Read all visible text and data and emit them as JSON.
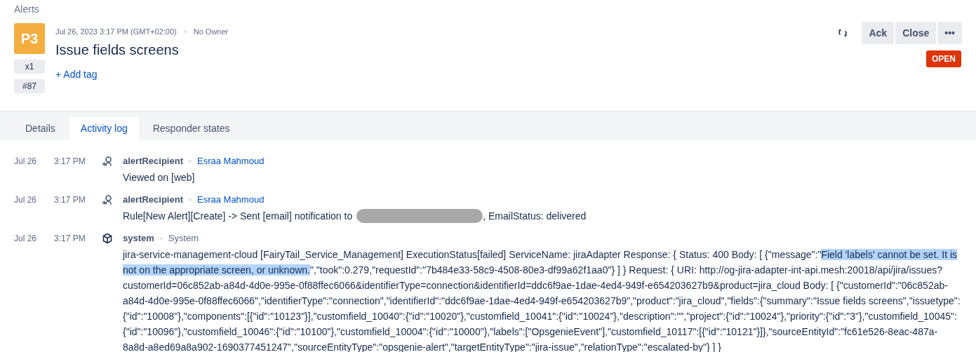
{
  "breadcrumb": "Alerts",
  "alert": {
    "priority": "P3",
    "count": "x1",
    "number": "#87",
    "datetime": "Jul 26, 2023 3:17 PM (GMT+02:00)",
    "owner": "No Owner",
    "title": "Issue fields screens",
    "add_tag": "+ Add tag",
    "status": "OPEN"
  },
  "actions": [
    "Ack",
    "Close",
    "•••"
  ],
  "tabs": [
    {
      "label": "Details",
      "selected": false
    },
    {
      "label": "Activity log",
      "selected": true
    },
    {
      "label": "Responder states",
      "selected": false
    }
  ],
  "log": [
    {
      "date": "Jul 26",
      "time": "3:17 PM",
      "kind": "user",
      "actor": "alertRecipient",
      "source": "Esraa Mahmoud",
      "source_link": true,
      "message": [
        {
          "text": "Viewed on [web]",
          "highlighted": false
        }
      ]
    },
    {
      "date": "Jul 26",
      "time": "3:17 PM",
      "kind": "user",
      "actor": "alertRecipient",
      "source": "Esraa Mahmoud",
      "source_link": true,
      "message": [
        {
          "text": "Rule[New Alert][Create] -> Sent [email] notification to",
          "highlighted": false
        }
      ],
      "redacted": true,
      "message_after": ", EmailStatus: delivered"
    },
    {
      "date": "Jul 26",
      "time": "3:17 PM",
      "kind": "system",
      "actor": "system",
      "source": "System",
      "source_link": false,
      "message": [
        {
          "text": "jira-service-management-cloud [FairyTail_Service_Management] ExecutionStatus[failed] ServiceName: jiraAdapter Response: { Status: 400 Body: [ {\"message\":\"",
          "highlighted": false
        },
        {
          "text": "Field 'labels' cannot be set. It is not on the appropriate screen, or unknown.",
          "highlighted": true
        },
        {
          "text": "\",\"took\":0.279,\"requestId\":\"7b484e33-58c9-4508-80e3-df99a62f1aa0\"} ] } Request: { URI: http://og-jira-adapter-int-api.mesh:20018/api/jira/issues?customerId=06c852ab-a84d-4d0e-995e-0f88ffec6066&identifierType=connection&identifierId=ddc6f9ae-1dae-4ed4-949f-e654203627b9&product=jira_cloud Body: [ {\"customerId\":\"06c852ab-a84d-4d0e-995e-0f88ffec6066\",\"identifierType\":\"connection\",\"identifierId\":\"ddc6f9ae-1dae-4ed4-949f-e654203627b9\",\"product\":\"jira_cloud\",\"fields\":{\"summary\":\"Issue fields screens\",\"issuetype\":{\"id\":\"10008\"},\"components\":[{\"id\":\"10123\"}],\"customfield_10040\":{\"id\":\"10020\"},\"customfield_10041\":{\"id\":\"10024\"},\"description\":\"\",\"project\":{\"id\":\"10024\"},\"priority\":{\"id\":\"3\"},\"customfield_10045\":{\"id\":\"10096\"},\"customfield_10046\":{\"id\":\"10100\"},\"customfield_10004\":{\"id\":\"10000\"},\"labels\":[\"OpsgenieEvent\"],\"customfield_10117\":[{\"id\":\"10121\"}]},\"sourceEntityId\":\"fc61e526-8eac-487a-8a8d-a8ed69a8a902-1690377451247\",\"sourceEntityType\":\"opsgenie-alert\",\"targetEntityType\":\"jira-issue\",\"relationType\":\"escalated-by\"} ] }",
          "highlighted": false
        }
      ]
    }
  ]
}
